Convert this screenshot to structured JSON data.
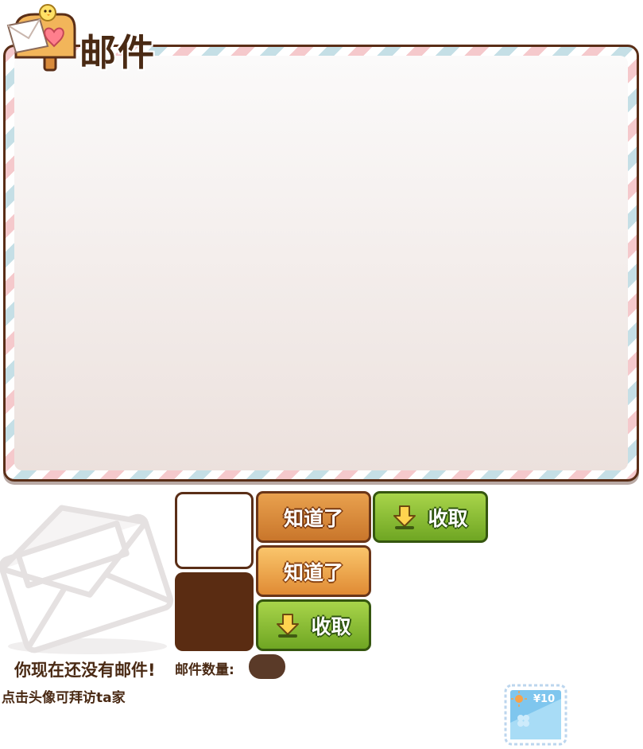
{
  "title": "邮件",
  "buttons": {
    "confirm_1": "知道了",
    "confirm_2": "知道了",
    "collect_1": "收取",
    "collect_2": "收取"
  },
  "mail_count_label": "邮件数量:",
  "empty_message": "你现在还没有邮件!",
  "visit_hint": "点击头像可拜访ta家",
  "stamp_price": "¥10",
  "colors": {
    "frame": "#5a2e17",
    "text": "#4a2a14",
    "orange_button": "#d98a3a",
    "green_button": "#8cc13a",
    "stripe_red": "#f5c9cc",
    "stripe_blue": "#c5dfe6"
  }
}
